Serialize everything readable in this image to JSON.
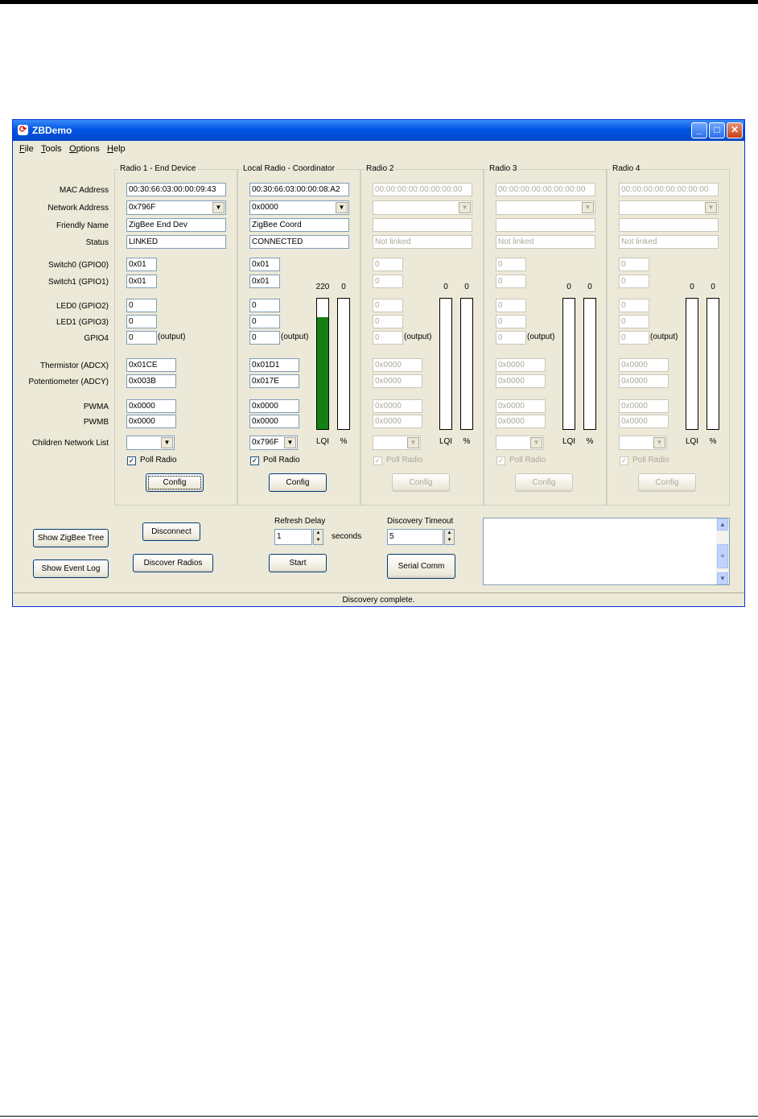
{
  "window": {
    "title": "ZBDemo"
  },
  "menu": [
    "File",
    "Tools",
    "Options",
    "Help"
  ],
  "row_labels": [
    "MAC Address",
    "Network Address",
    "Friendly Name",
    "Status",
    "Switch0 (GPIO0)",
    "Switch1 (GPIO1)",
    "LED0 (GPIO2)",
    "LED1 (GPIO3)",
    "GPIO4",
    "Thermistor (ADCX)",
    "Potentiometer (ADCY)",
    "PWMA",
    "PWMB",
    "Children Network List"
  ],
  "output_label": "(output)",
  "lqi_label": "LQI",
  "pct_label": "%",
  "poll_label": "Poll Radio",
  "config_label": "Config",
  "radios": [
    {
      "title": "Radio 1 - End Device",
      "mac": "00:30:66:03:00:00:09:43",
      "net": "0x796F",
      "name": "ZigBee End Dev",
      "status": "LINKED",
      "sw0": "0x01",
      "sw1": "0x01",
      "led0": "0",
      "led1": "0",
      "gpio4": "0",
      "adcx": "0x01CE",
      "adcy": "0x003B",
      "pwma": "0x0000",
      "pwmb": "0x0000",
      "children": "",
      "poll": true,
      "enabled": true
    },
    {
      "title": "Local Radio - Coordinator",
      "mac": "00:30:66:03:00:00:08:A2",
      "net": "0x0000",
      "name": "ZigBee Coord",
      "status": "CONNECTED",
      "sw0": "0x01",
      "sw1": "0x01",
      "led0": "0",
      "led1": "0",
      "gpio4": "0",
      "adcx": "0x01D1",
      "adcy": "0x017E",
      "pwma": "0x0000",
      "pwmb": "0x0000",
      "children": "0x796F",
      "poll": true,
      "enabled": true,
      "lqi": "220",
      "pct": "0",
      "lqi_fill": 0.86,
      "pct_fill": 0
    },
    {
      "title": "Radio 2",
      "mac": "00:00:00:00:00:00:00:00",
      "net": "",
      "name": "",
      "status": "Not linked",
      "sw0": "0",
      "sw1": "0",
      "led0": "0",
      "led1": "0",
      "gpio4": "0",
      "adcx": "0x0000",
      "adcy": "0x0000",
      "pwma": "0x0000",
      "pwmb": "0x0000",
      "children": "",
      "poll": true,
      "enabled": false,
      "lqi": "0",
      "pct": "0",
      "lqi_fill": 0,
      "pct_fill": 0
    },
    {
      "title": "Radio 3",
      "mac": "00:00:00:00:00:00:00:00",
      "net": "",
      "name": "",
      "status": "Not linked",
      "sw0": "0",
      "sw1": "0",
      "led0": "0",
      "led1": "0",
      "gpio4": "0",
      "adcx": "0x0000",
      "adcy": "0x0000",
      "pwma": "0x0000",
      "pwmb": "0x0000",
      "children": "",
      "poll": true,
      "enabled": false,
      "lqi": "0",
      "pct": "0",
      "lqi_fill": 0,
      "pct_fill": 0
    },
    {
      "title": "Radio 4",
      "mac": "00:00:00:00:00:00:00:00",
      "net": "",
      "name": "",
      "status": "Not linked",
      "sw0": "0",
      "sw1": "0",
      "led0": "0",
      "led1": "0",
      "gpio4": "0",
      "adcx": "0x0000",
      "adcy": "0x0000",
      "pwma": "0x0000",
      "pwmb": "0x0000",
      "children": "",
      "poll": true,
      "enabled": false,
      "lqi": "0",
      "pct": "0",
      "lqi_fill": 0,
      "pct_fill": 0
    }
  ],
  "buttons": {
    "show_tree": "Show ZigBee Tree",
    "show_log": "Show  Event Log",
    "disconnect": "Disconnect",
    "discover": "Discover Radios",
    "start": "Start",
    "serial": "Serial Comm"
  },
  "refresh": {
    "label": "Refresh Delay",
    "value": "1",
    "unit": "seconds"
  },
  "discovery": {
    "label": "Discovery Timeout",
    "value": "5"
  },
  "status_text": "Discovery complete.",
  "colors": {
    "lqi_bar": "#148014",
    "title_bar": "#0054e3"
  }
}
